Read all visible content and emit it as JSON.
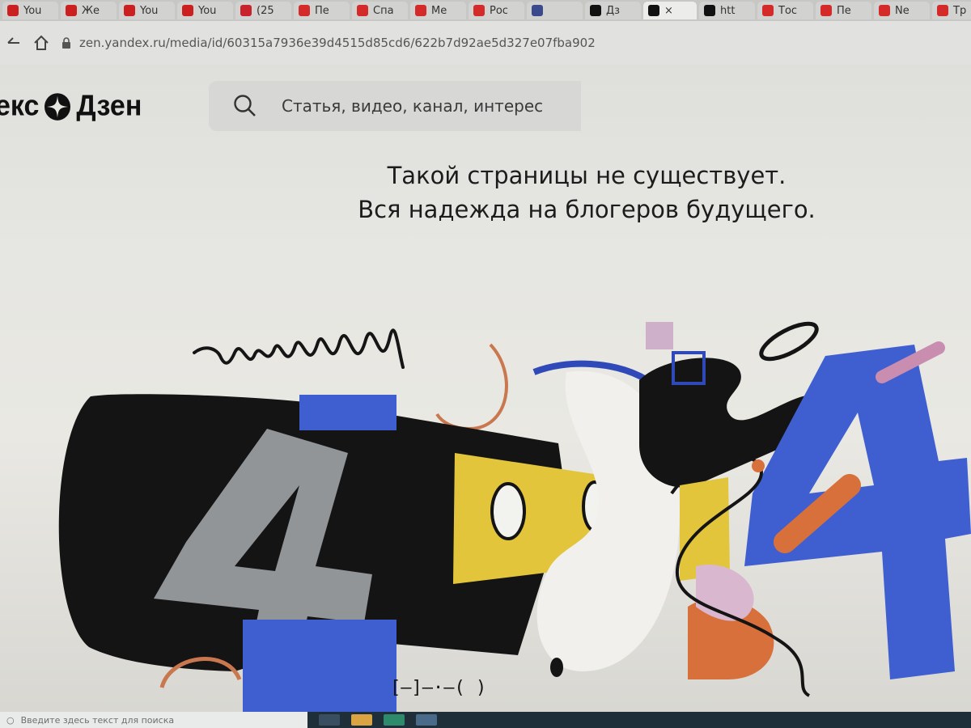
{
  "tabs": [
    {
      "label": "You",
      "icon_color": "#cc1f1f",
      "active": false
    },
    {
      "label": "Же",
      "icon_color": "#cc1f1f",
      "active": false
    },
    {
      "label": "You",
      "icon_color": "#cc1f1f",
      "active": false
    },
    {
      "label": "You",
      "icon_color": "#cc1f1f",
      "active": false
    },
    {
      "label": "(25",
      "icon_color": "#c8232c",
      "active": false
    },
    {
      "label": "Пе",
      "icon_color": "#d42a2a",
      "active": false
    },
    {
      "label": "Спа",
      "icon_color": "#d42a2a",
      "active": false
    },
    {
      "label": "Ме",
      "icon_color": "#d42a2a",
      "active": false
    },
    {
      "label": "Рос",
      "icon_color": "#d42a2a",
      "active": false
    },
    {
      "label": "",
      "icon_color": "#3b4a8c",
      "active": false
    },
    {
      "label": "Дз",
      "icon_color": "#111111",
      "active": false
    },
    {
      "label": "×",
      "icon_color": "#111111",
      "active": true
    },
    {
      "label": "htt",
      "icon_color": "#111111",
      "active": false
    },
    {
      "label": "Тос",
      "icon_color": "#d42a2a",
      "active": false
    },
    {
      "label": "Пе",
      "icon_color": "#d42a2a",
      "active": false
    },
    {
      "label": "Ne",
      "icon_color": "#d42a2a",
      "active": false
    },
    {
      "label": "Тр",
      "icon_color": "#d42a2a",
      "active": false
    }
  ],
  "toolbar": {
    "url": "zen.yandex.ru/media/id/60315a7936e39d4515d85cd6/622b7d92ae5d327e07fba902"
  },
  "header": {
    "logo_left": "екс",
    "logo_right": "Дзен",
    "search_placeholder": "Статья, видео, канал, интерес"
  },
  "message": {
    "line1": "Такой страницы не существует.",
    "line2": "Вся надежда на блогеров будущего."
  },
  "illustration": {
    "megaphone_text": "[–]—·–( )"
  },
  "taskbar": {
    "search_placeholder": "Введите здесь текст для поиска"
  },
  "colors": {
    "blue": "#3f5fd0",
    "yellow": "#e2c53a",
    "orange": "#d8703c",
    "pink": "#c98db0",
    "black": "#141414"
  }
}
